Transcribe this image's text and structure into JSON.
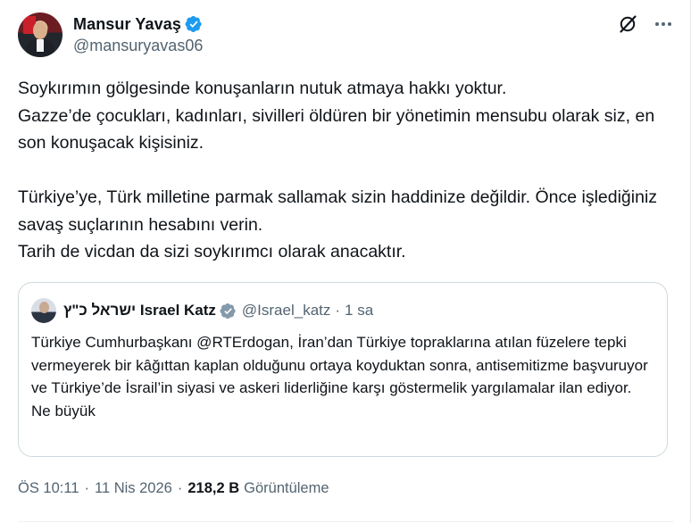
{
  "author": {
    "name": "Mansur Yavaş",
    "handle": "@mansuryavas06"
  },
  "tweet": {
    "text": "Soykırımın gölgesinde konuşanların nutuk atmaya hakkı yoktur.\nGazze’de çocukları, kadınları, sivilleri öldüren bir yönetimin mensubu olarak siz, en son konuşacak kişisiniz.\n\nTürkiye’ye, Türk milletine parmak sallamak sizin haddinize değildir. Önce işlediğiniz savaş suçlarının hesabını verin.\nTarih de vicdan da sizi soykırımcı olarak anacaktır."
  },
  "quoted": {
    "name": "ישראל כ\"ץ Israel Katz",
    "handle": "@Israel_katz",
    "separator": "·",
    "time": "1 sa",
    "text": "Türkiye Cumhurbaşkanı @RTErdogan, İran’dan Türkiye topraklarına atılan füzelere tepki vermeyerek bir kâğıttan kaplan olduğunu ortaya koyduktan sonra, antisemitizme başvuruyor ve Türkiye’de İsrail’in siyasi ve askeri liderliğine karşı göstermelik yargılamalar ilan ediyor.\nNe büyük"
  },
  "meta": {
    "time": "ÖS 10:11",
    "dot": "·",
    "date": "11 Nis 2026",
    "views_count": "218,2 B",
    "views_label": "Görüntüleme"
  },
  "icons": {
    "verified": "verified-badge-icon",
    "grok": "grok-icon",
    "more": "more-icon"
  },
  "colors": {
    "verified": "#1d9bf0",
    "text": "#0f1419",
    "secondary": "#536471",
    "border": "#cfd9de"
  }
}
